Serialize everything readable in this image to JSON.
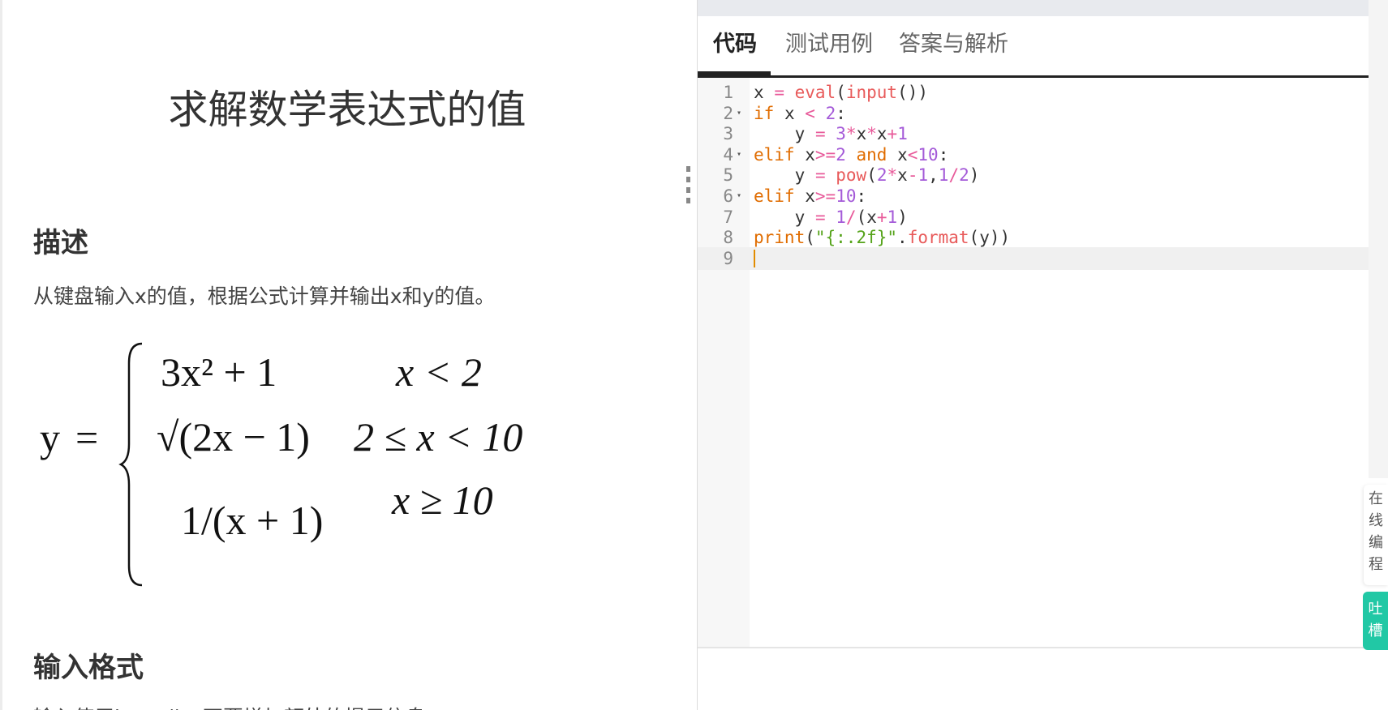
{
  "problem": {
    "title": "求解数学表达式的值",
    "description_heading": "描述",
    "description_text": "从键盘输入x的值，根据公式计算并输出x和y的值。",
    "input_heading": "输入格式",
    "input_text": "输入使用input()，不要增加额外的提示信息。"
  },
  "formula": {
    "lhs": "y",
    "eq": "=",
    "case1_expr": "3x² + 1",
    "case1_cond": "x < 2",
    "case2_expr": "√(2x − 1)",
    "case2_cond": "2 ≤ x < 10",
    "case3_expr": "1/(x + 1)",
    "case3_cond": "x ≥ 10"
  },
  "tabs": [
    {
      "label": "代码",
      "active": true
    },
    {
      "label": "测试用例",
      "active": false
    },
    {
      "label": "答案与解析",
      "active": false
    }
  ],
  "editor": {
    "lines": [
      {
        "n": "1",
        "fold": false
      },
      {
        "n": "2",
        "fold": true
      },
      {
        "n": "3",
        "fold": false
      },
      {
        "n": "4",
        "fold": true
      },
      {
        "n": "5",
        "fold": false
      },
      {
        "n": "6",
        "fold": true
      },
      {
        "n": "7",
        "fold": false
      },
      {
        "n": "8",
        "fold": false
      },
      {
        "n": "9",
        "fold": false
      }
    ],
    "code": [
      "x = eval(input())",
      "if x < 2:",
      "    y = 3*x*x+1",
      "elif x>=2 and x<10:",
      "    y = pow(2*x-1,1/2)",
      "elif x>=10:",
      "    y = 1/(x+1)",
      "print(\"{:.2f}\".format(y))",
      ""
    ],
    "active_line": 9,
    "fold_glyph": "▾"
  },
  "side": {
    "online_chars": [
      "在",
      "线",
      "编",
      "程"
    ],
    "feedback_chars": [
      "吐",
      "槽"
    ]
  },
  "colors": {
    "accent": "#21c8a5",
    "keyword": "#e06c00",
    "builtin": "#e85a5a",
    "number": "#a45ad8",
    "string": "#55a31a"
  }
}
